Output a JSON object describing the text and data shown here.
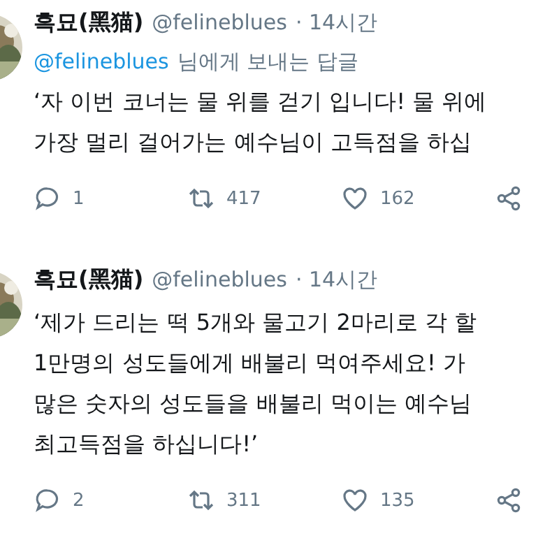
{
  "tweets": [
    {
      "name": "흑묘(黑猫)",
      "handle": "@felineblues",
      "time": "· 14시간",
      "reply_to": {
        "handle": "@felineblues",
        "text": "님에게 보내는 답글"
      },
      "lines": [
        "‘자 이번 코너는 물 위를 걷기 입니다! 물 위에",
        "가장 멀리 걸어가는 예수님이 고득점을 하십"
      ],
      "replies": "1",
      "retweets": "417",
      "likes": "162"
    },
    {
      "name": "흑묘(黑猫)",
      "handle": "@felineblues",
      "time": "· 14시간",
      "lines": [
        "‘제가 드리는 떡 5개와 물고기 2마리로 각 할",
        "1만명의 성도들에게 배불리 먹여주세요! 가",
        "많은 숫자의 성도들을 배불리 먹이는 예수님",
        "최고득점을 하십니다!’"
      ],
      "replies": "2",
      "retweets": "311",
      "likes": "135"
    }
  ]
}
